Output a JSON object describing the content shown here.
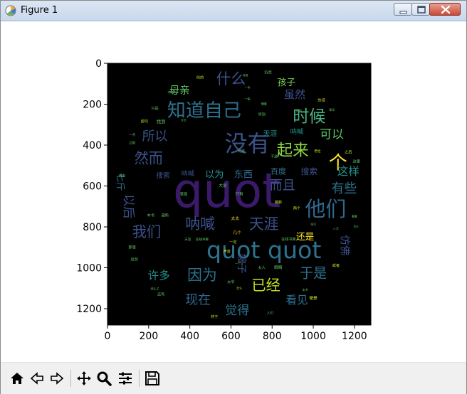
{
  "window": {
    "title": "Figure 1"
  },
  "icons": {
    "app": "matplotlib-figure-icon",
    "minimize": "minimize-icon",
    "maximize": "maximize-icon",
    "close": "close-icon"
  },
  "toolbar": {
    "tools": [
      {
        "name": "home-icon",
        "tip": "Reset original view"
      },
      {
        "name": "back-arrow-icon",
        "tip": "Back to previous view"
      },
      {
        "name": "forward-arrow-icon",
        "tip": "Forward to next view"
      },
      {
        "name": "pan-icon",
        "tip": "Pan axes"
      },
      {
        "name": "zoom-icon",
        "tip": "Zoom to rectangle"
      },
      {
        "name": "subplots-icon",
        "tip": "Configure subplots"
      },
      {
        "name": "save-icon",
        "tip": "Save the figure"
      }
    ]
  },
  "chart_data": {
    "type": "image",
    "description_free": true,
    "x_ticks": [
      "0",
      "200",
      "400",
      "600",
      "800",
      "1000",
      "1200"
    ],
    "y_ticks": [
      "0",
      "200",
      "400",
      "600",
      "800",
      "1000",
      "1200"
    ],
    "xlim": [
      0,
      1280
    ],
    "ylim": [
      1280,
      0
    ],
    "background": "#000000",
    "palette": [
      "#440154",
      "#3b528b",
      "#21918c",
      "#5ec962",
      "#fde725",
      "#2c728e",
      "#31688e"
    ],
    "words": [
      {
        "text": "quot",
        "x": 580,
        "y": 640,
        "size": 230,
        "color": "#3b1a6b",
        "rot": 0
      },
      {
        "text": "没有",
        "x": 680,
        "y": 400,
        "size": 110,
        "color": "#3b528b",
        "rot": 0
      },
      {
        "text": "知道自己",
        "x": 470,
        "y": 235,
        "size": 90,
        "color": "#2c728e",
        "rot": 0
      },
      {
        "text": "quot quot",
        "x": 760,
        "y": 920,
        "size": 115,
        "color": "#2c728e",
        "rot": 0
      },
      {
        "text": "他们",
        "x": 1060,
        "y": 720,
        "size": 100,
        "color": "#31688e",
        "rot": 0
      },
      {
        "text": "时候",
        "x": 980,
        "y": 265,
        "size": 80,
        "color": "#4ab580",
        "rot": 0
      },
      {
        "text": "什么",
        "x": 600,
        "y": 80,
        "size": 72,
        "color": "#3b528b",
        "rot": 0
      },
      {
        "text": "起来",
        "x": 900,
        "y": 430,
        "size": 78,
        "color": "#8fd744",
        "rot": 0
      },
      {
        "text": "个",
        "x": 1120,
        "y": 490,
        "size": 90,
        "color": "#fde725",
        "rot": 0
      },
      {
        "text": "所以",
        "x": 230,
        "y": 360,
        "size": 62,
        "color": "#3b528b",
        "rot": 0
      },
      {
        "text": "然而",
        "x": 200,
        "y": 470,
        "size": 70,
        "color": "#3b528b",
        "rot": 0
      },
      {
        "text": "可以",
        "x": 1090,
        "y": 350,
        "size": 58,
        "color": "#5ec962",
        "rot": 0
      },
      {
        "text": "而且",
        "x": 850,
        "y": 600,
        "size": 62,
        "color": "#3b528b",
        "rot": 0
      },
      {
        "text": "有些",
        "x": 1150,
        "y": 615,
        "size": 62,
        "color": "#2c728e",
        "rot": 0
      },
      {
        "text": "这样",
        "x": 1170,
        "y": 530,
        "size": 54,
        "color": "#21918c",
        "rot": 0
      },
      {
        "text": "呐喊",
        "x": 450,
        "y": 790,
        "size": 72,
        "color": "#3b528b",
        "rot": 0
      },
      {
        "text": "天涯",
        "x": 760,
        "y": 790,
        "size": 72,
        "color": "#3b528b",
        "rot": 0
      },
      {
        "text": "我们",
        "x": 190,
        "y": 830,
        "size": 70,
        "color": "#3b528b",
        "rot": 0
      },
      {
        "text": "因为",
        "x": 460,
        "y": 1040,
        "size": 72,
        "color": "#2c728e",
        "rot": 0
      },
      {
        "text": "已经",
        "x": 770,
        "y": 1090,
        "size": 70,
        "color": "#c4e021",
        "rot": 0
      },
      {
        "text": "于是",
        "x": 1000,
        "y": 1030,
        "size": 66,
        "color": "#2c728e",
        "rot": 0
      },
      {
        "text": "许多",
        "x": 250,
        "y": 1040,
        "size": 54,
        "color": "#21918c",
        "rot": 0
      },
      {
        "text": "现在",
        "x": 440,
        "y": 1160,
        "size": 62,
        "color": "#31688e",
        "rot": 0
      },
      {
        "text": "觉得",
        "x": 630,
        "y": 1210,
        "size": 60,
        "color": "#2c728e",
        "rot": 0
      },
      {
        "text": "看见",
        "x": 920,
        "y": 1160,
        "size": 54,
        "color": "#2c728e",
        "rot": 0
      },
      {
        "text": "母亲",
        "x": 350,
        "y": 135,
        "size": 50,
        "color": "#5ec962",
        "rot": 0
      },
      {
        "text": "虽然",
        "x": 910,
        "y": 155,
        "size": 52,
        "color": "#3b528b",
        "rot": 0
      },
      {
        "text": "孩子",
        "x": 870,
        "y": 95,
        "size": 44,
        "color": "#7ad151",
        "rot": 0
      },
      {
        "text": "以为",
        "x": 520,
        "y": 545,
        "size": 46,
        "color": "#21918c",
        "rot": 0
      },
      {
        "text": "东西",
        "x": 660,
        "y": 545,
        "size": 46,
        "color": "#31688e",
        "rot": 0
      },
      {
        "text": "百度",
        "x": 830,
        "y": 530,
        "size": 38,
        "color": "#2c728e",
        "rot": 0
      },
      {
        "text": "搜索",
        "x": 980,
        "y": 530,
        "size": 40,
        "color": "#3b528b",
        "rot": 0
      },
      {
        "text": "搜索",
        "x": 270,
        "y": 550,
        "size": 34,
        "color": "#3b528b",
        "rot": 0
      },
      {
        "text": "呐喊",
        "x": 390,
        "y": 540,
        "size": 32,
        "color": "#3b528b",
        "rot": 0
      },
      {
        "text": "天涯",
        "x": 790,
        "y": 345,
        "size": 34,
        "color": "#21918c",
        "rot": 0
      },
      {
        "text": "呐喊",
        "x": 920,
        "y": 335,
        "size": 32,
        "color": "#21918c",
        "rot": 0
      },
      {
        "text": "还是",
        "x": 960,
        "y": 850,
        "size": 44,
        "color": "#fde725",
        "rot": 0
      },
      {
        "text": "仿佛",
        "x": 1150,
        "y": 890,
        "size": 50,
        "color": "#3b528b",
        "rot": 90
      },
      {
        "text": "以后",
        "x": 100,
        "y": 700,
        "size": 60,
        "color": "#3b528b",
        "rot": 90
      },
      {
        "text": "七斤",
        "x": 60,
        "y": 580,
        "size": 44,
        "color": "#2c728e",
        "rot": 90
      },
      {
        "text": "嫂子",
        "x": 650,
        "y": 980,
        "size": 48,
        "color": "#3b528b",
        "rot": 90
      },
      {
        "text": "太太",
        "x": 620,
        "y": 760,
        "size": 20,
        "color": "#fde725",
        "rot": 0
      },
      {
        "text": "几个",
        "x": 630,
        "y": 830,
        "size": 20,
        "color": "#fde725",
        "rot": 0
      },
      {
        "text": "在线书库",
        "x": 880,
        "y": 860,
        "size": 18,
        "color": "#5ec962",
        "rot": 0
      },
      {
        "text": "最新",
        "x": 830,
        "y": 680,
        "size": 18,
        "color": "#c4e021",
        "rot": 0
      },
      {
        "text": "两个",
        "x": 920,
        "y": 710,
        "size": 18,
        "color": "#c4e021",
        "rot": 0
      },
      {
        "text": "只有",
        "x": 640,
        "y": 640,
        "size": 20,
        "color": "#5ec962",
        "rot": 0
      },
      {
        "text": "大家",
        "x": 560,
        "y": 600,
        "size": 20,
        "color": "#5ec962",
        "rot": 0
      },
      {
        "text": "这里",
        "x": 1210,
        "y": 480,
        "size": 18,
        "color": "#5ec962",
        "rot": 0
      },
      {
        "text": "之后",
        "x": 1170,
        "y": 435,
        "size": 18,
        "color": "#c4e021",
        "rot": 0
      },
      {
        "text": "便是",
        "x": 1000,
        "y": 1150,
        "size": 20,
        "color": "#c4e021",
        "rot": 0
      },
      {
        "text": "终于",
        "x": 520,
        "y": 1240,
        "size": 18,
        "color": "#c4e021",
        "rot": 0
      },
      {
        "text": "眼睛",
        "x": 830,
        "y": 1000,
        "size": 20,
        "color": "#5ec962",
        "rot": 0
      },
      {
        "text": "或者",
        "x": 1110,
        "y": 990,
        "size": 18,
        "color": "#c4e021",
        "rot": 0
      },
      {
        "text": "里面",
        "x": 370,
        "y": 640,
        "size": 18,
        "color": "#5ec962",
        "rot": 0
      },
      {
        "text": "本书",
        "x": 210,
        "y": 745,
        "size": 18,
        "color": "#5ec962",
        "rot": 0
      },
      {
        "text": "最新",
        "x": 280,
        "y": 745,
        "size": 18,
        "color": "#5ec962",
        "rot": 0
      },
      {
        "text": "那里",
        "x": 120,
        "y": 900,
        "size": 18,
        "color": "#5ec962",
        "rot": 0
      },
      {
        "text": "忽然",
        "x": 130,
        "y": 960,
        "size": 18,
        "color": "#5ec962",
        "rot": 0
      },
      {
        "text": "还有",
        "x": 260,
        "y": 1130,
        "size": 18,
        "color": "#5ec962",
        "rot": 0
      },
      {
        "text": "找到",
        "x": 260,
        "y": 285,
        "size": 22,
        "color": "#5ec962",
        "rot": 0
      },
      {
        "text": "即可",
        "x": 180,
        "y": 285,
        "size": 18,
        "color": "#c4e021",
        "rot": 0
      },
      {
        "text": "只是",
        "x": 230,
        "y": 220,
        "size": 18,
        "color": "#5ec962",
        "rot": 0
      },
      {
        "text": "不能",
        "x": 310,
        "y": 145,
        "size": 18,
        "color": "#5ec962",
        "rot": 0
      },
      {
        "text": "似的",
        "x": 450,
        "y": 70,
        "size": 18,
        "color": "#c4e021",
        "rot": 0
      },
      {
        "text": "仍然",
        "x": 780,
        "y": 45,
        "size": 18,
        "color": "#5ec962",
        "rot": 0
      },
      {
        "text": "听到",
        "x": 750,
        "y": 250,
        "size": 18,
        "color": "#5ec962",
        "rot": 0
      },
      {
        "text": "的话",
        "x": 1040,
        "y": 180,
        "size": 18,
        "color": "#c4e021",
        "rot": 0
      },
      {
        "text": "声音",
        "x": 580,
        "y": 920,
        "size": 18,
        "color": "#c4e021",
        "rot": 0
      },
      {
        "text": "女人",
        "x": 750,
        "y": 1000,
        "size": 18,
        "color": "#5ec962",
        "rot": 0
      },
      {
        "text": "人们",
        "x": 790,
        "y": 1220,
        "size": 16,
        "color": "#5ec962",
        "rot": 0
      },
      {
        "text": "太爷",
        "x": 600,
        "y": 1070,
        "size": 18,
        "color": "#5ec962",
        "rot": 0
      },
      {
        "text": "北京",
        "x": 650,
        "y": 430,
        "size": 18,
        "color": "#5ec962",
        "rot": 0
      },
      {
        "text": "一定",
        "x": 610,
        "y": 875,
        "size": 18,
        "color": "#c4e021",
        "rot": 0
      },
      {
        "text": "天涯",
        "x": 390,
        "y": 860,
        "size": 16,
        "color": "#5ec962",
        "rot": 0
      },
      {
        "text": "在线书库",
        "x": 460,
        "y": 860,
        "size": 16,
        "color": "#5ec962",
        "rot": 0
      },
      {
        "text": "老栓",
        "x": 1020,
        "y": 430,
        "size": 16,
        "color": "#c4e021",
        "rot": 0
      },
      {
        "text": "不是",
        "x": 810,
        "y": 455,
        "size": 16,
        "color": "#5ec962",
        "rot": 0
      },
      {
        "text": "未庄",
        "x": 70,
        "y": 550,
        "size": 16,
        "color": "#5ec962",
        "rot": 0
      },
      {
        "text": "立刻",
        "x": 120,
        "y": 390,
        "size": 16,
        "color": "#5ec962",
        "rot": 0
      },
      {
        "text": "一点",
        "x": 120,
        "y": 350,
        "size": 16,
        "color": "#5ec962",
        "rot": 0
      },
      {
        "text": "老头子",
        "x": 230,
        "y": 1105,
        "size": 14,
        "color": "#5ec962",
        "rot": 0
      },
      {
        "text": "今天",
        "x": 370,
        "y": 280,
        "size": 14,
        "color": "#5ec962",
        "rot": 0
      },
      {
        "text": "一件",
        "x": 680,
        "y": 120,
        "size": 14,
        "color": "#5ec962",
        "rot": 0
      },
      {
        "text": "一般",
        "x": 680,
        "y": 175,
        "size": 14,
        "color": "#5ec962",
        "rot": 0
      },
      {
        "text": "慢慢",
        "x": 760,
        "y": 200,
        "size": 14,
        "color": "#5ec962",
        "rot": 0
      },
      {
        "text": "记得",
        "x": 930,
        "y": 235,
        "size": 14,
        "color": "#5ec962",
        "rot": 0
      },
      {
        "text": "革命",
        "x": 1090,
        "y": 230,
        "size": 14,
        "color": "#5ec962",
        "rot": 0
      },
      {
        "text": "八字",
        "x": 1110,
        "y": 810,
        "size": 14,
        "color": "#5ec962",
        "rot": 0
      },
      {
        "text": "阿Q",
        "x": 1000,
        "y": 790,
        "size": 14,
        "color": "#5ec962",
        "rot": 0
      },
      {
        "text": "一个人",
        "x": 640,
        "y": 980,
        "size": 14,
        "color": "#5ec962",
        "rot": 0
      },
      {
        "text": "怎么",
        "x": 640,
        "y": 1100,
        "size": 14,
        "color": "#c4e021",
        "rot": 0
      },
      {
        "text": "本书",
        "x": 960,
        "y": 1110,
        "size": 14,
        "color": "#5ec962",
        "rot": 0
      },
      {
        "text": "非常",
        "x": 670,
        "y": 60,
        "size": 14,
        "color": "#5ec962",
        "rot": 0
      },
      {
        "text": "看看",
        "x": 1200,
        "y": 750,
        "size": 14,
        "color": "#5ec962",
        "rot": 0
      },
      {
        "text": "别人",
        "x": 1210,
        "y": 800,
        "size": 14,
        "color": "#5ec962",
        "rot": 0
      }
    ]
  }
}
